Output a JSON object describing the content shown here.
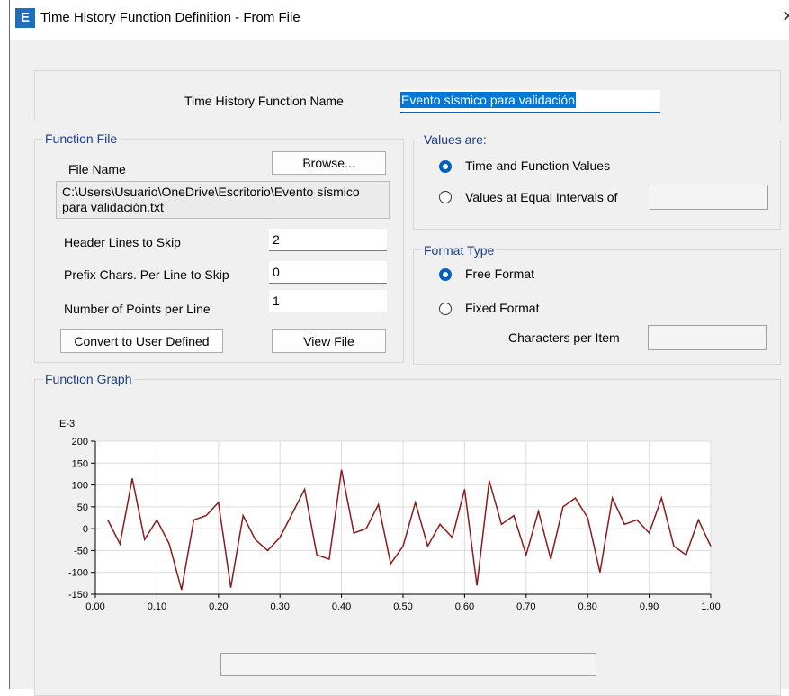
{
  "window": {
    "icon_letter": "E",
    "title": "Time History Function Definition  - From File",
    "close_glyph": "✕"
  },
  "function_name": {
    "label": "Time History Function Name",
    "value": "Evento sísmico para validación"
  },
  "function_file": {
    "group_label": "Function File",
    "file_name_label": "File Name",
    "browse_label": "Browse...",
    "path": "C:\\Users\\Usuario\\OneDrive\\Escritorio\\Evento sísmico\npara validación.txt",
    "header_lines_label": "Header Lines to Skip",
    "header_lines_value": "2",
    "prefix_chars_label": "Prefix Chars. Per Line to Skip",
    "prefix_chars_value": "0",
    "points_per_line_label": "Number of Points per Line",
    "points_per_line_value": "1",
    "convert_label": "Convert to User Defined",
    "view_file_label": "View File"
  },
  "values_are": {
    "group_label": "Values are:",
    "option_time": "Time and Function Values",
    "option_equal": "Values at Equal Intervals of",
    "selected": "time",
    "equal_interval_value": ""
  },
  "format_type": {
    "group_label": "Format Type",
    "option_free": "Free Format",
    "option_fixed": "Fixed Format",
    "selected": "free",
    "chars_per_item_label": "Characters per Item",
    "chars_per_item_value": ""
  },
  "graph": {
    "group_label": "Function Graph",
    "status_value": ""
  },
  "chart_data": {
    "type": "line",
    "title": "",
    "xlabel": "",
    "ylabel": "",
    "y_multiplier_label": "E-3",
    "xlim": [
      0,
      1
    ],
    "ylim": [
      -150,
      200
    ],
    "x_ticks": [
      "0.00",
      "0.10",
      "0.20",
      "0.30",
      "0.40",
      "0.50",
      "0.60",
      "0.70",
      "0.80",
      "0.90",
      "1.00"
    ],
    "y_ticks": [
      "200",
      "150",
      "100",
      "50",
      "0",
      "-50",
      "-100",
      "-150"
    ],
    "y_tick_values": [
      200,
      150,
      100,
      50,
      0,
      -50,
      -100,
      -150
    ],
    "grid": true,
    "line_color": "#8b1a1a",
    "series": [
      {
        "x": [
          0.02,
          0.04,
          0.06,
          0.08,
          0.1,
          0.12,
          0.14,
          0.16,
          0.18,
          0.2,
          0.22,
          0.24,
          0.26,
          0.28,
          0.3,
          0.32,
          0.34,
          0.36,
          0.38,
          0.4,
          0.42,
          0.44,
          0.46,
          0.48,
          0.5,
          0.52,
          0.54,
          0.56,
          0.58,
          0.6,
          0.62,
          0.64,
          0.66,
          0.68,
          0.7,
          0.72,
          0.74,
          0.76,
          0.78,
          0.8,
          0.82,
          0.84,
          0.86,
          0.88,
          0.9,
          0.92,
          0.94,
          0.96,
          0.98,
          1.0
        ],
        "y": [
          20,
          -35,
          115,
          -25,
          20,
          -35,
          -140,
          20,
          30,
          60,
          -135,
          30,
          -25,
          -50,
          -20,
          35,
          90,
          -60,
          -70,
          135,
          -10,
          0,
          55,
          -80,
          -40,
          60,
          -40,
          10,
          -20,
          90,
          -130,
          110,
          10,
          30,
          -60,
          40,
          -70,
          50,
          70,
          25,
          -100,
          70,
          10,
          20,
          -10,
          70,
          -40,
          -60,
          20,
          -40
        ]
      }
    ]
  }
}
